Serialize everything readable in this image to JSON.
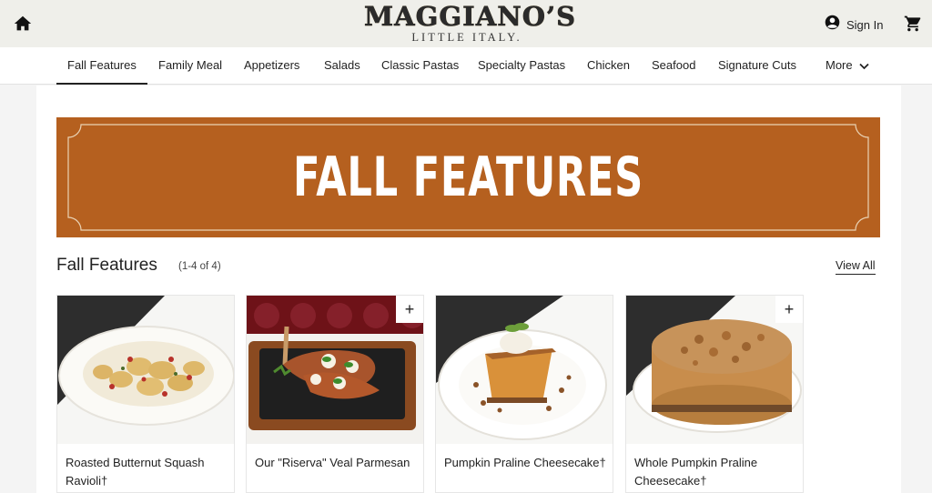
{
  "header": {
    "logo_main": "MAGGIANO’S",
    "logo_sub": "LITTLE ITALY.",
    "signin_label": "Sign In",
    "home_icon": "home-icon",
    "account_icon": "account-circle-icon",
    "cart_icon": "cart-icon"
  },
  "nav": {
    "items": [
      "Fall Features",
      "Family Meal",
      "Appetizers",
      "Salads",
      "Classic Pastas",
      "Specialty Pastas",
      "Chicken",
      "Seafood",
      "Signature Cuts"
    ],
    "more_label": "More",
    "active": "Fall Features"
  },
  "banner": {
    "title": "FALL FEATURES",
    "color": "#b5601f"
  },
  "section": {
    "title": "Fall Features",
    "count": "(1-4 of 4)",
    "view_all": "View All"
  },
  "cards": [
    {
      "name": "Roasted Butternut Squash Ravioli†",
      "plus": ""
    },
    {
      "name": "Our \"Riserva\" Veal Parmesan",
      "plus": "+"
    },
    {
      "name": "Pumpkin Praline Cheesecake†",
      "plus": ""
    },
    {
      "name": "Whole Pumpkin Praline Cheesecake†",
      "plus": "+"
    }
  ]
}
